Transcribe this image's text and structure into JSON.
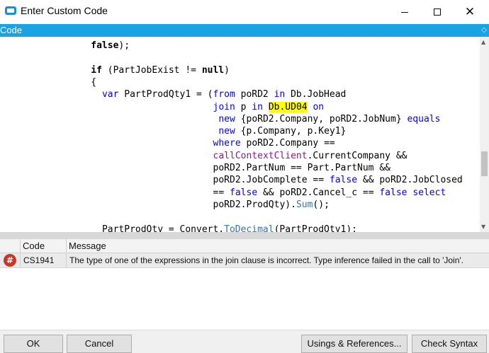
{
  "window": {
    "title": "Enter Custom Code",
    "icons": {
      "app": "app-window-icon",
      "minimize": "minimize-icon",
      "maximize": "maximize-icon",
      "close": "close-icon"
    }
  },
  "code_panel": {
    "label": "Code",
    "pin_icon": "pin-icon",
    "lines": [
      {
        "indent": 16,
        "segments": [
          {
            "text": "false",
            "style": "bk"
          },
          {
            "text": ");",
            "style": ""
          }
        ]
      },
      {
        "indent": 0,
        "segments": []
      },
      {
        "indent": 16,
        "segments": [
          {
            "text": "if",
            "style": "bk"
          },
          {
            "text": " (PartJobExist != ",
            "style": ""
          },
          {
            "text": "null",
            "style": "bk"
          },
          {
            "text": ")",
            "style": ""
          }
        ]
      },
      {
        "indent": 16,
        "segments": [
          {
            "text": "{",
            "style": ""
          }
        ]
      },
      {
        "indent": 18,
        "segments": [
          {
            "text": "var",
            "style": "kw"
          },
          {
            "text": " PartProdQty1 = (",
            "style": ""
          },
          {
            "text": "from",
            "style": "kw"
          },
          {
            "text": " poRD2 ",
            "style": ""
          },
          {
            "text": "in",
            "style": "kw"
          },
          {
            "text": " Db.JobHead",
            "style": ""
          }
        ]
      },
      {
        "indent": 38,
        "segments": [
          {
            "text": "join",
            "style": "kw"
          },
          {
            "text": " p ",
            "style": ""
          },
          {
            "text": "in",
            "style": "kw"
          },
          {
            "text": " ",
            "style": ""
          },
          {
            "text": "Db.UD04",
            "style": "hl"
          },
          {
            "text": " ",
            "style": ""
          },
          {
            "text": "on",
            "style": "kw"
          }
        ]
      },
      {
        "indent": 39,
        "segments": [
          {
            "text": "new",
            "style": "kw"
          },
          {
            "text": " {poRD2.Company, poRD2.JobNum} ",
            "style": ""
          },
          {
            "text": "equals",
            "style": "kw"
          }
        ]
      },
      {
        "indent": 39,
        "segments": [
          {
            "text": "new",
            "style": "kw"
          },
          {
            "text": " {p.Company, p.Key1}",
            "style": ""
          }
        ]
      },
      {
        "indent": 38,
        "segments": [
          {
            "text": "where",
            "style": "kw"
          },
          {
            "text": " poRD2.Company ==",
            "style": ""
          }
        ]
      },
      {
        "indent": 38,
        "segments": [
          {
            "text": "callContextClient",
            "style": "pu"
          },
          {
            "text": ".CurrentCompany &&",
            "style": ""
          }
        ]
      },
      {
        "indent": 38,
        "segments": [
          {
            "text": "poRD2.PartNum == Part.PartNum &&",
            "style": ""
          }
        ]
      },
      {
        "indent": 38,
        "segments": [
          {
            "text": "poRD2.JobComplete == ",
            "style": ""
          },
          {
            "text": "false",
            "style": "kw"
          },
          {
            "text": " && poRD2.JobClosed",
            "style": ""
          }
        ]
      },
      {
        "indent": 38,
        "segments": [
          {
            "text": "== ",
            "style": ""
          },
          {
            "text": "false",
            "style": "kw"
          },
          {
            "text": " && poRD2.Cancel_c == ",
            "style": ""
          },
          {
            "text": "false",
            "style": "kw"
          },
          {
            "text": " ",
            "style": ""
          },
          {
            "text": "select",
            "style": "kw"
          }
        ]
      },
      {
        "indent": 38,
        "segments": [
          {
            "text": "poRD2.ProdQty).",
            "style": ""
          },
          {
            "text": "Sum",
            "style": "lnk"
          },
          {
            "text": "();",
            "style": ""
          }
        ]
      },
      {
        "indent": 0,
        "segments": []
      },
      {
        "indent": 18,
        "segments": [
          {
            "text": "PartProdQty = Convert.",
            "style": ""
          },
          {
            "text": "ToDecimal",
            "style": "lnk"
          },
          {
            "text": "(PartProdQty1);",
            "style": ""
          }
        ]
      }
    ]
  },
  "errors": {
    "columns": {
      "code": "Code",
      "message": "Message"
    },
    "rows": [
      {
        "icon": "error-icon",
        "glyph": "#",
        "code": "CS1941",
        "message": "The type of one of the expressions in the join clause is incorrect.  Type inference failed in the call to 'Join'."
      }
    ]
  },
  "footer": {
    "ok_label": "OK",
    "cancel_label": "Cancel",
    "usings_label": "Usings & References...",
    "check_syntax_label": "Check Syntax"
  }
}
